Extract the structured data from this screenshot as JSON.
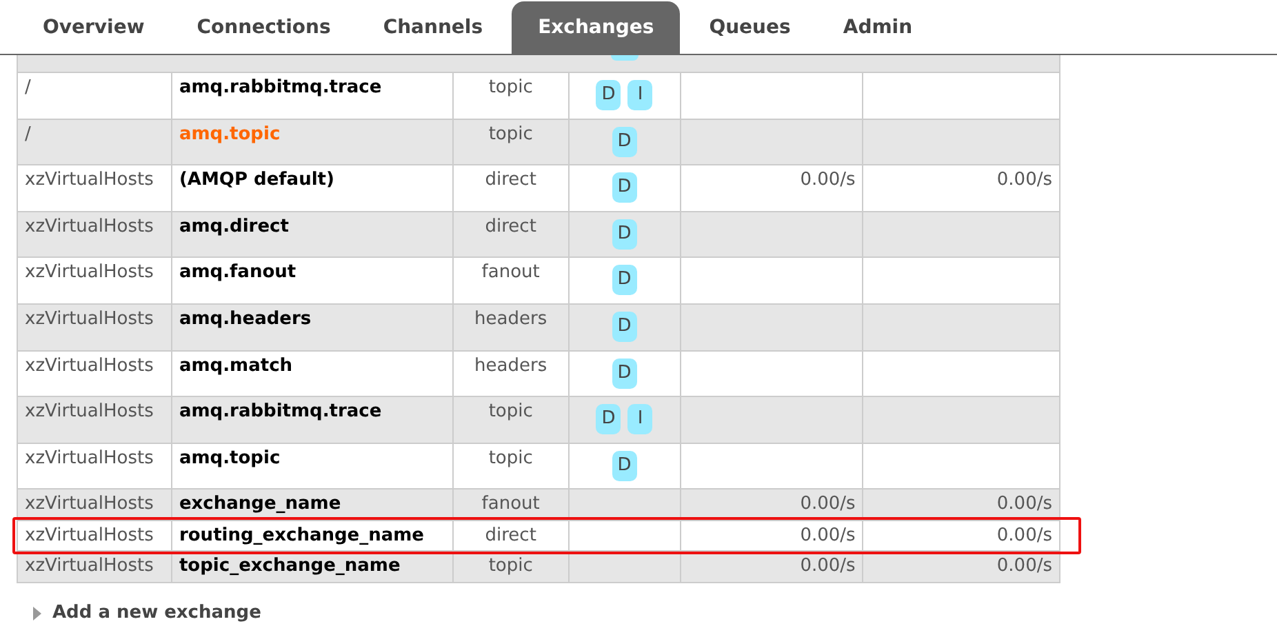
{
  "tabs": [
    {
      "label": "Overview",
      "selected": false
    },
    {
      "label": "Connections",
      "selected": false
    },
    {
      "label": "Channels",
      "selected": false
    },
    {
      "label": "Exchanges",
      "selected": true
    },
    {
      "label": "Queues",
      "selected": false
    },
    {
      "label": "Admin",
      "selected": false
    }
  ],
  "rows": [
    {
      "vhost": "/",
      "name": "amq.rabbitmq.trace",
      "type": "topic",
      "features": [
        "D",
        "I"
      ],
      "hovered": false,
      "highlighted": false
    },
    {
      "vhost": "/",
      "name": "amq.topic",
      "type": "topic",
      "features": [
        "D"
      ],
      "hovered": true,
      "highlighted": false
    },
    {
      "vhost": "xzVirtualHosts",
      "name": "(AMQP default)",
      "type": "direct",
      "features": [
        "D"
      ],
      "rate_in": "0.00/s",
      "rate_out": "0.00/s",
      "hovered": false,
      "highlighted": false
    },
    {
      "vhost": "xzVirtualHosts",
      "name": "amq.direct",
      "type": "direct",
      "features": [
        "D"
      ],
      "hovered": false,
      "highlighted": false
    },
    {
      "vhost": "xzVirtualHosts",
      "name": "amq.fanout",
      "type": "fanout",
      "features": [
        "D"
      ],
      "hovered": false,
      "highlighted": false
    },
    {
      "vhost": "xzVirtualHosts",
      "name": "amq.headers",
      "type": "headers",
      "features": [
        "D"
      ],
      "hovered": false,
      "highlighted": false
    },
    {
      "vhost": "xzVirtualHosts",
      "name": "amq.match",
      "type": "headers",
      "features": [
        "D"
      ],
      "hovered": false,
      "highlighted": false
    },
    {
      "vhost": "xzVirtualHosts",
      "name": "amq.rabbitmq.trace",
      "type": "topic",
      "features": [
        "D",
        "I"
      ],
      "hovered": false,
      "highlighted": false
    },
    {
      "vhost": "xzVirtualHosts",
      "name": "amq.topic",
      "type": "topic",
      "features": [
        "D"
      ],
      "hovered": false,
      "highlighted": false
    },
    {
      "vhost": "xzVirtualHosts",
      "name": "exchange_name",
      "type": "fanout",
      "rate_in": "0.00/s",
      "rate_out": "0.00/s",
      "hovered": false,
      "highlighted": false
    },
    {
      "vhost": "xzVirtualHosts",
      "name": "routing_exchange_name",
      "type": "direct",
      "rate_in": "0.00/s",
      "rate_out": "0.00/s",
      "hovered": false,
      "highlighted": true
    },
    {
      "vhost": "xzVirtualHosts",
      "name": "topic_exchange_name",
      "type": "topic",
      "rate_in": "0.00/s",
      "rate_out": "0.00/s",
      "hovered": false,
      "highlighted": false
    }
  ],
  "add_section": {
    "label": "Add a new exchange",
    "expanded": false
  }
}
